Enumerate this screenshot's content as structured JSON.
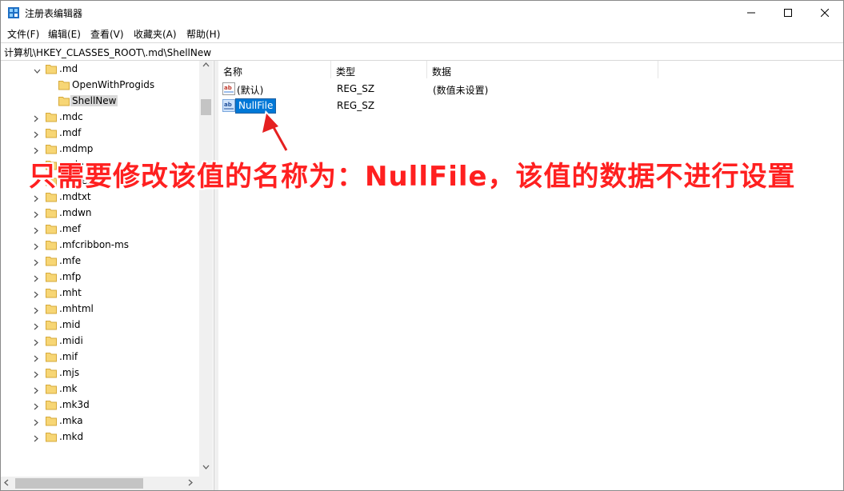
{
  "window": {
    "title": "注册表编辑器"
  },
  "menu": [
    "文件(F)",
    "编辑(E)",
    "查看(V)",
    "收藏夹(A)",
    "帮助(H)"
  ],
  "address": "计算机\\HKEY_CLASSES_ROOT\\.md\\ShellNew",
  "tree": [
    {
      "label": ".md",
      "expanded": true,
      "indent": 0
    },
    {
      "label": "OpenWithProgids",
      "indent": 1
    },
    {
      "label": "ShellNew",
      "indent": 1,
      "selected": true
    },
    {
      "label": ".mdc",
      "indent": 0
    },
    {
      "label": ".mdf",
      "indent": 0
    },
    {
      "label": ".mdmp",
      "indent": 0
    },
    {
      "label": ".mdp",
      "indent": 0
    },
    {
      "label": ".mdtext",
      "indent": 0
    },
    {
      "label": ".mdtxt",
      "indent": 0
    },
    {
      "label": ".mdwn",
      "indent": 0
    },
    {
      "label": ".mef",
      "indent": 0
    },
    {
      "label": ".mfcribbon-ms",
      "indent": 0
    },
    {
      "label": ".mfe",
      "indent": 0
    },
    {
      "label": ".mfp",
      "indent": 0
    },
    {
      "label": ".mht",
      "indent": 0
    },
    {
      "label": ".mhtml",
      "indent": 0
    },
    {
      "label": ".mid",
      "indent": 0
    },
    {
      "label": ".midi",
      "indent": 0
    },
    {
      "label": ".mif",
      "indent": 0
    },
    {
      "label": ".mjs",
      "indent": 0
    },
    {
      "label": ".mk",
      "indent": 0
    },
    {
      "label": ".mk3d",
      "indent": 0
    },
    {
      "label": ".mka",
      "indent": 0
    },
    {
      "label": ".mkd",
      "indent": 0
    }
  ],
  "columns": {
    "name": "名称",
    "type": "类型",
    "data": "数据"
  },
  "values": [
    {
      "name": "(默认)",
      "type": "REG_SZ",
      "data": "(数值未设置)"
    },
    {
      "name": "NullFile",
      "type": "REG_SZ",
      "data": "",
      "editing": true
    }
  ],
  "annotation": "只需要修改该值的名称为：NullFile，该值的数据不进行设置",
  "colors": {
    "accent": "#0078d7",
    "annotation": "#ff2020",
    "folder": "#f7d675"
  }
}
